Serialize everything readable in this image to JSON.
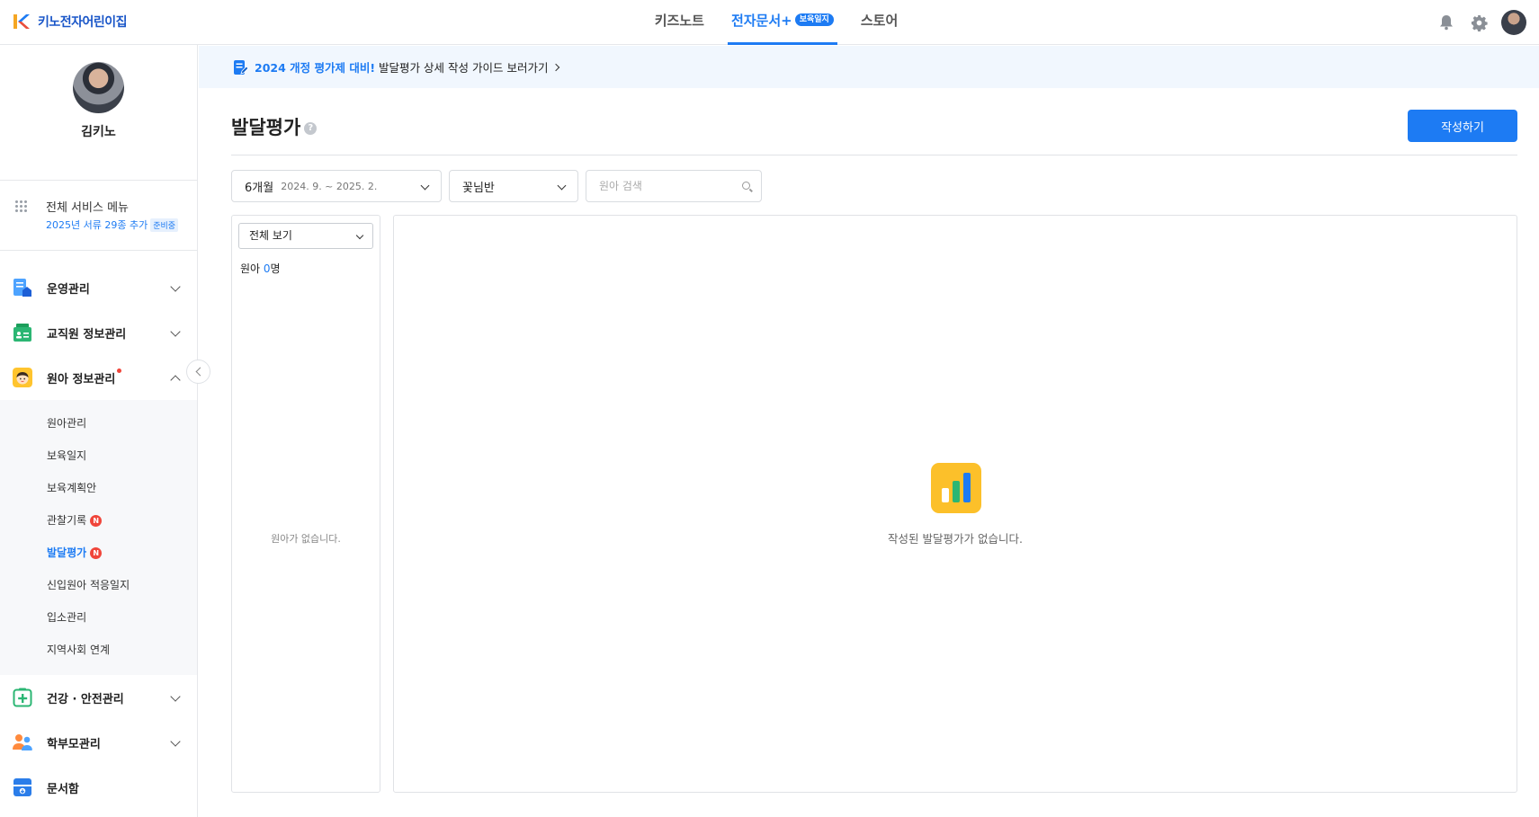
{
  "header": {
    "logo_text": "키노전자어린이집",
    "nav": [
      {
        "label": "키즈노트"
      },
      {
        "label": "전자문서+",
        "badge": "보육일지",
        "active": true
      },
      {
        "label": "스토어"
      }
    ],
    "icons": [
      "bell-icon",
      "gear-icon",
      "avatar"
    ]
  },
  "sidebar": {
    "profile_name": "김키노",
    "all_menu_title": "전체 서비스 메뉴",
    "all_menu_sub": "2025년 서류 29종 추가",
    "all_menu_tag": "준비중",
    "groups": [
      {
        "label": "운영관리",
        "icon": "document-home-icon",
        "expanded": false
      },
      {
        "label": "교직원 정보관리",
        "icon": "staff-card-icon",
        "expanded": false
      },
      {
        "label": "원아 정보관리",
        "icon": "child-face-icon",
        "expanded": true,
        "new_dot": true
      },
      {
        "label": "건강 · 안전관리",
        "icon": "plus-box-icon",
        "expanded": false
      },
      {
        "label": "학부모관리",
        "icon": "parents-icon",
        "expanded": false
      },
      {
        "label": "문서함",
        "icon": "archive-icon",
        "expanded": false
      }
    ],
    "sub_items": [
      {
        "label": "원아관리"
      },
      {
        "label": "보육일지"
      },
      {
        "label": "보육계획안"
      },
      {
        "label": "관찰기록",
        "new": "N"
      },
      {
        "label": "발달평가",
        "new": "N",
        "active": true
      },
      {
        "label": "신입원아 적응일지"
      },
      {
        "label": "입소관리"
      },
      {
        "label": "지역사회 연계"
      }
    ]
  },
  "banner": {
    "highlight": "2024 개정 평가제 대비!",
    "text": "발달평가 상세 작성 가이드 보러가기"
  },
  "page": {
    "title": "발달평가",
    "help": "?",
    "write_button": "작성하기"
  },
  "filters": {
    "period_label": "6개월",
    "period_range": "2024. 9. ~ 2025. 2.",
    "class_label": "꽃님반",
    "search_placeholder": "원아 검색"
  },
  "left_panel": {
    "view_select": "전체 보기",
    "count_prefix": "원아 ",
    "count_value": "0",
    "count_suffix": "명",
    "empty_text": "원아가 없습니다."
  },
  "right_panel": {
    "empty_text": "작성된 발달평가가 없습니다."
  },
  "colors": {
    "accent": "#1d7bf3",
    "new_badge": "#f0453a",
    "empty_icon_bg": "#fcc02a"
  }
}
